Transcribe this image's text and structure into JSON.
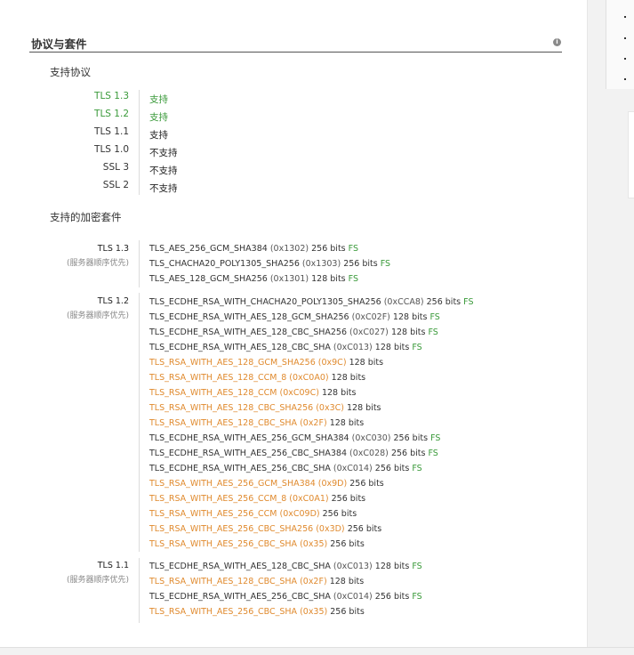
{
  "section": {
    "title": "协议与套件",
    "info_icon": "info-icon"
  },
  "protocols": {
    "heading": "支持协议",
    "items": [
      {
        "name": "TLS 1.3",
        "status": "支持",
        "supported": true
      },
      {
        "name": "TLS 1.2",
        "status": "支持",
        "supported": true
      },
      {
        "name": "TLS 1.1",
        "status": "支持",
        "supported": false
      },
      {
        "name": "TLS 1.0",
        "status": "不支持",
        "supported": false
      },
      {
        "name": "SSL 3",
        "status": "不支持",
        "supported": false
      },
      {
        "name": "SSL 2",
        "status": "不支持",
        "supported": false
      }
    ]
  },
  "suites": {
    "heading": "支持的加密套件",
    "groups": [
      {
        "protocol": "TLS 1.3",
        "note": "(服务器顺序优先)",
        "items": [
          {
            "name": "TLS_AES_256_GCM_SHA384",
            "code": "(0x1302)",
            "bits": "256 bits",
            "fs": "FS",
            "weak": false
          },
          {
            "name": "TLS_CHACHA20_POLY1305_SHA256",
            "code": "(0x1303)",
            "bits": "256 bits",
            "fs": "FS",
            "weak": false
          },
          {
            "name": "TLS_AES_128_GCM_SHA256",
            "code": "(0x1301)",
            "bits": "128 bits",
            "fs": "FS",
            "weak": false
          }
        ]
      },
      {
        "protocol": "TLS 1.2",
        "note": "(服务器顺序优先)",
        "items": [
          {
            "name": "TLS_ECDHE_RSA_WITH_CHACHA20_POLY1305_SHA256",
            "code": "(0xCCA8)",
            "bits": "256 bits",
            "fs": "FS",
            "weak": false
          },
          {
            "name": "TLS_ECDHE_RSA_WITH_AES_128_GCM_SHA256",
            "code": "(0xC02F)",
            "bits": "128 bits",
            "fs": "FS",
            "weak": false
          },
          {
            "name": "TLS_ECDHE_RSA_WITH_AES_128_CBC_SHA256",
            "code": "(0xC027)",
            "bits": "128 bits",
            "fs": "FS",
            "weak": false
          },
          {
            "name": "TLS_ECDHE_RSA_WITH_AES_128_CBC_SHA",
            "code": "(0xC013)",
            "bits": "128 bits",
            "fs": "FS",
            "weak": false
          },
          {
            "name": "TLS_RSA_WITH_AES_128_GCM_SHA256",
            "code": "(0x9C)",
            "bits": "128 bits",
            "fs": "",
            "weak": true
          },
          {
            "name": "TLS_RSA_WITH_AES_128_CCM_8",
            "code": "(0xC0A0)",
            "bits": "128 bits",
            "fs": "",
            "weak": true
          },
          {
            "name": "TLS_RSA_WITH_AES_128_CCM",
            "code": "(0xC09C)",
            "bits": "128 bits",
            "fs": "",
            "weak": true
          },
          {
            "name": "TLS_RSA_WITH_AES_128_CBC_SHA256",
            "code": "(0x3C)",
            "bits": "128 bits",
            "fs": "",
            "weak": true
          },
          {
            "name": "TLS_RSA_WITH_AES_128_CBC_SHA",
            "code": "(0x2F)",
            "bits": "128 bits",
            "fs": "",
            "weak": true
          },
          {
            "name": "TLS_ECDHE_RSA_WITH_AES_256_GCM_SHA384",
            "code": "(0xC030)",
            "bits": "256 bits",
            "fs": "FS",
            "weak": false
          },
          {
            "name": "TLS_ECDHE_RSA_WITH_AES_256_CBC_SHA384",
            "code": "(0xC028)",
            "bits": "256 bits",
            "fs": "FS",
            "weak": false
          },
          {
            "name": "TLS_ECDHE_RSA_WITH_AES_256_CBC_SHA",
            "code": "(0xC014)",
            "bits": "256 bits",
            "fs": "FS",
            "weak": false
          },
          {
            "name": "TLS_RSA_WITH_AES_256_GCM_SHA384",
            "code": "(0x9D)",
            "bits": "256 bits",
            "fs": "",
            "weak": true
          },
          {
            "name": "TLS_RSA_WITH_AES_256_CCM_8",
            "code": "(0xC0A1)",
            "bits": "256 bits",
            "fs": "",
            "weak": true
          },
          {
            "name": "TLS_RSA_WITH_AES_256_CCM",
            "code": "(0xC09D)",
            "bits": "256 bits",
            "fs": "",
            "weak": true
          },
          {
            "name": "TLS_RSA_WITH_AES_256_CBC_SHA256",
            "code": "(0x3D)",
            "bits": "256 bits",
            "fs": "",
            "weak": true
          },
          {
            "name": "TLS_RSA_WITH_AES_256_CBC_SHA",
            "code": "(0x35)",
            "bits": "256 bits",
            "fs": "",
            "weak": true
          }
        ]
      },
      {
        "protocol": "TLS 1.1",
        "note": "(服务器顺序优先)",
        "items": [
          {
            "name": "TLS_ECDHE_RSA_WITH_AES_128_CBC_SHA",
            "code": "(0xC013)",
            "bits": "128 bits",
            "fs": "FS",
            "weak": false
          },
          {
            "name": "TLS_RSA_WITH_AES_128_CBC_SHA",
            "code": "(0x2F)",
            "bits": "128 bits",
            "fs": "",
            "weak": true
          },
          {
            "name": "TLS_ECDHE_RSA_WITH_AES_256_CBC_SHA",
            "code": "(0xC014)",
            "bits": "256 bits",
            "fs": "FS",
            "weak": false
          },
          {
            "name": "TLS_RSA_WITH_AES_256_CBC_SHA",
            "code": "(0x35)",
            "bits": "256 bits",
            "fs": "",
            "weak": true
          }
        ]
      }
    ]
  },
  "colors": {
    "supported": "#3a9a3a",
    "weak": "#e08a2e",
    "fs": "#3a9a3a"
  }
}
